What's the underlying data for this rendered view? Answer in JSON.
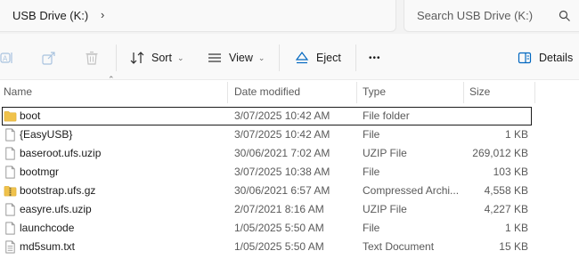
{
  "address": {
    "location": "USB Drive (K:)",
    "chevron": "›"
  },
  "search": {
    "placeholder": "Search USB Drive (K:)"
  },
  "toolbar": {
    "sort_label": "Sort",
    "view_label": "View",
    "eject_label": "Eject",
    "more_label": "•••",
    "details_label": "Details",
    "caret": "⌄"
  },
  "columns": {
    "name": "Name",
    "date": "Date modified",
    "type": "Type",
    "size": "Size"
  },
  "files": [
    {
      "name": "boot",
      "date": "3/07/2025 10:42 AM",
      "type": "File folder",
      "size": "",
      "icon": "folder-icon"
    },
    {
      "name": "{EasyUSB}",
      "date": "3/07/2025 10:42 AM",
      "type": "File",
      "size": "1 KB",
      "icon": "file-icon"
    },
    {
      "name": "baseroot.ufs.uzip",
      "date": "30/06/2021 7:02 AM",
      "type": "UZIP File",
      "size": "269,012 KB",
      "icon": "file-icon"
    },
    {
      "name": "bootmgr",
      "date": "3/07/2025 10:38 AM",
      "type": "File",
      "size": "103 KB",
      "icon": "file-icon"
    },
    {
      "name": "bootstrap.ufs.gz",
      "date": "30/06/2021 6:57 AM",
      "type": "Compressed Archi...",
      "size": "4,558 KB",
      "icon": "zip-folder-icon"
    },
    {
      "name": "easyre.ufs.uzip",
      "date": "2/07/2021 8:16 AM",
      "type": "UZIP File",
      "size": "4,227 KB",
      "icon": "file-icon"
    },
    {
      "name": "launchcode",
      "date": "1/05/2025 5:50 AM",
      "type": "File",
      "size": "1 KB",
      "icon": "file-icon"
    },
    {
      "name": "md5sum.txt",
      "date": "1/05/2025 5:50 AM",
      "type": "Text Document",
      "size": "15 KB",
      "icon": "text-file-icon"
    }
  ],
  "colors": {
    "folder": "#f0c24b",
    "accent": "#0067c0",
    "selection_border": "#1b1b1b"
  }
}
